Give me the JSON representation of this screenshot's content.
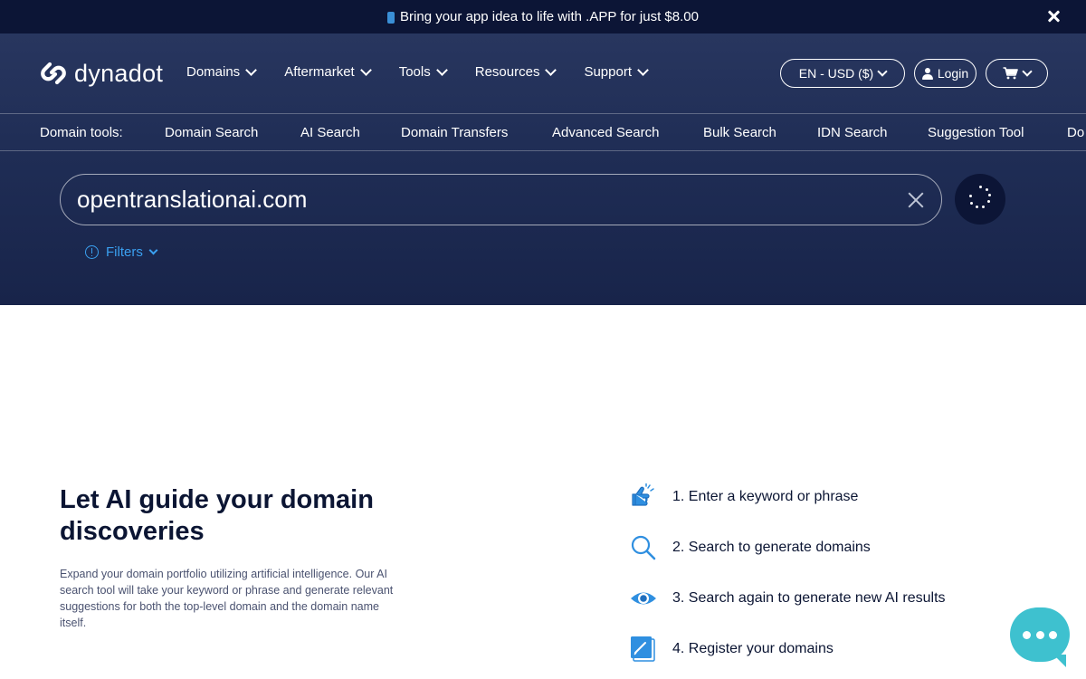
{
  "promo": {
    "text": "Bring your app idea to life with .APP for just $8.00"
  },
  "brand": {
    "name": "dynadot"
  },
  "nav": {
    "items": [
      {
        "label": "Domains"
      },
      {
        "label": "Aftermarket"
      },
      {
        "label": "Tools"
      },
      {
        "label": "Resources"
      },
      {
        "label": "Support"
      }
    ],
    "language": "EN - USD ($)",
    "login": "Login"
  },
  "toolbar": {
    "label": "Domain tools:",
    "links": [
      {
        "label": "Domain Search"
      },
      {
        "label": "AI Search"
      },
      {
        "label": "Domain Transfers"
      },
      {
        "label": "Advanced Search"
      },
      {
        "label": "Bulk Search"
      },
      {
        "label": "IDN Search"
      },
      {
        "label": "Suggestion Tool"
      },
      {
        "label": "Do"
      }
    ]
  },
  "search": {
    "value": "opentranslationai.com"
  },
  "filters": {
    "label": "Filters"
  },
  "content": {
    "headline": "Let AI guide your domain discoveries",
    "description": "Expand your domain portfolio utilizing artificial intelligence. Our AI search tool will take your keyword or phrase and generate relevant suggestions for both the top-level domain and the domain name itself.",
    "steps": [
      {
        "text": "1. Enter a keyword or phrase",
        "icon": "pointing-hand-icon"
      },
      {
        "text": "2. Search to generate domains",
        "icon": "magnifier-icon"
      },
      {
        "text": "3. Search again to generate new AI results",
        "icon": "eye-icon"
      },
      {
        "text": "4. Register your domains",
        "icon": "edit-note-icon"
      }
    ]
  },
  "colors": {
    "hero": "#1f2d55",
    "promo": "#0c1536",
    "accent": "#3aa0f0",
    "chat": "#3ec1cf"
  }
}
